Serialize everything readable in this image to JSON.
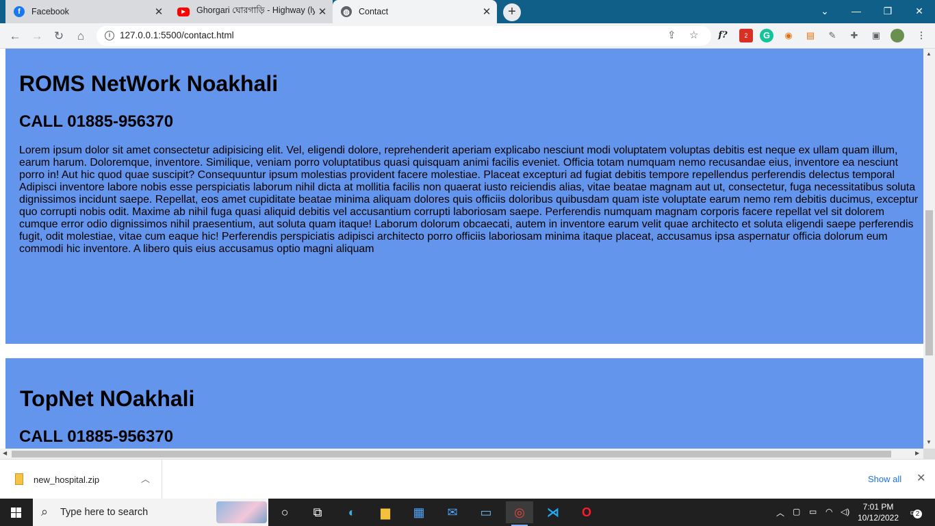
{
  "browser": {
    "tabs": [
      {
        "title": "Facebook",
        "icon": "facebook-icon",
        "color": "#1877f2"
      },
      {
        "title": "Ghorgari ঘোরগাড়ি - Highway (lyr",
        "icon": "youtube-icon",
        "color": "#ff0000"
      },
      {
        "title": "Contact",
        "icon": "globe-icon",
        "color": "#5f6368"
      }
    ],
    "address": "127.0.0.1:5500/contact.html",
    "extension_badge": "2"
  },
  "page": {
    "card1": {
      "title": "ROMS NetWork Noakhali",
      "phone": "CALL 01885-956370",
      "body": "Lorem ipsum dolor sit amet consectetur adipisicing elit. Vel, eligendi dolore, reprehenderit aperiam explicabo nesciunt modi voluptatem voluptas debitis est neque ex ullam quam illum, earum harum. Doloremque, inventore. Similique, veniam porro voluptatibus quasi quisquam animi facilis eveniet. Officia totam numquam nemo recusandae eius, inventore ea nesciunt porro in! Aut hic quod quae suscipit? Consequuntur ipsum molestias provident facere molestiae. Placeat excepturi ad fugiat debitis tempore repellendus perferendis delectus temporal Adipisci inventore labore nobis esse perspiciatis laborum nihil dicta at mollitia facilis non quaerat iusto reiciendis alias, vitae beatae magnam aut ut, consectetur, fuga necessitatibus soluta dignissimos incidunt saepe. Repellat, eos amet cupiditate beatae minima aliquam dolores quis officiis doloribus quibusdam quam iste voluptate earum nemo rem debitis ducimus, exceptur quo corrupti nobis odit. Maxime ab nihil fuga quasi aliquid debitis vel accusantium corrupti laboriosam saepe. Perferendis numquam magnam corporis facere repellat vel sit dolorem cumque error odio dignissimos nihil praesentium, aut soluta quam itaque! Laborum dolorum obcaecati, autem in inventore earum velit quae architecto et soluta eligendi saepe perferendis fugit, odit molestiae, vitae cum eaque hic! Perferendis perspiciatis adipisci architecto porro officiis laboriosam minima itaque placeat, accusamus ipsa aspernatur officia dolorum eum commodi hic inventore. A libero quis eius accusamus optio magni aliquam"
    },
    "card2": {
      "title": "TopNet NOakhali",
      "phone": "CALL 01885-956370"
    },
    "card_color": "#6495ed"
  },
  "downloads": {
    "file": "new_hospital.zip",
    "show_all": "Show all"
  },
  "taskbar": {
    "search_placeholder": "Type here to search",
    "time": "7:01 PM",
    "date": "10/12/2022",
    "notification_count": "2"
  }
}
